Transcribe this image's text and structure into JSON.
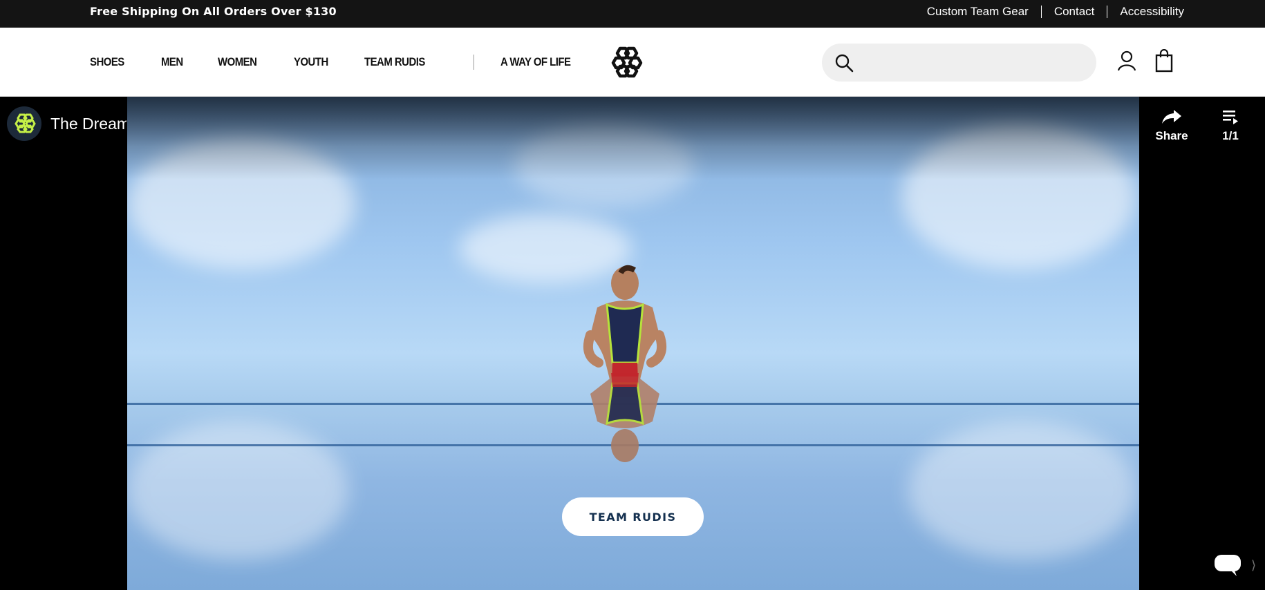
{
  "announcement": {
    "promo": "Free Shipping On All Orders Over $130",
    "links": [
      "Custom Team Gear",
      "Contact",
      "Accessibility"
    ]
  },
  "nav": {
    "items": [
      "SHOES",
      "MEN",
      "WOMEN",
      "YOUTH",
      "TEAM RUDIS"
    ],
    "secondary": "A WAY OF LIFE"
  },
  "search": {
    "placeholder": "",
    "value": ""
  },
  "video": {
    "title": "The Dream",
    "share_label": "Share",
    "playlist_label": "1/1",
    "cta_label": "TEAM RUDIS"
  },
  "colors": {
    "topbar": "#141414",
    "accent_green": "#c6f047",
    "cta_text": "#14304f"
  }
}
